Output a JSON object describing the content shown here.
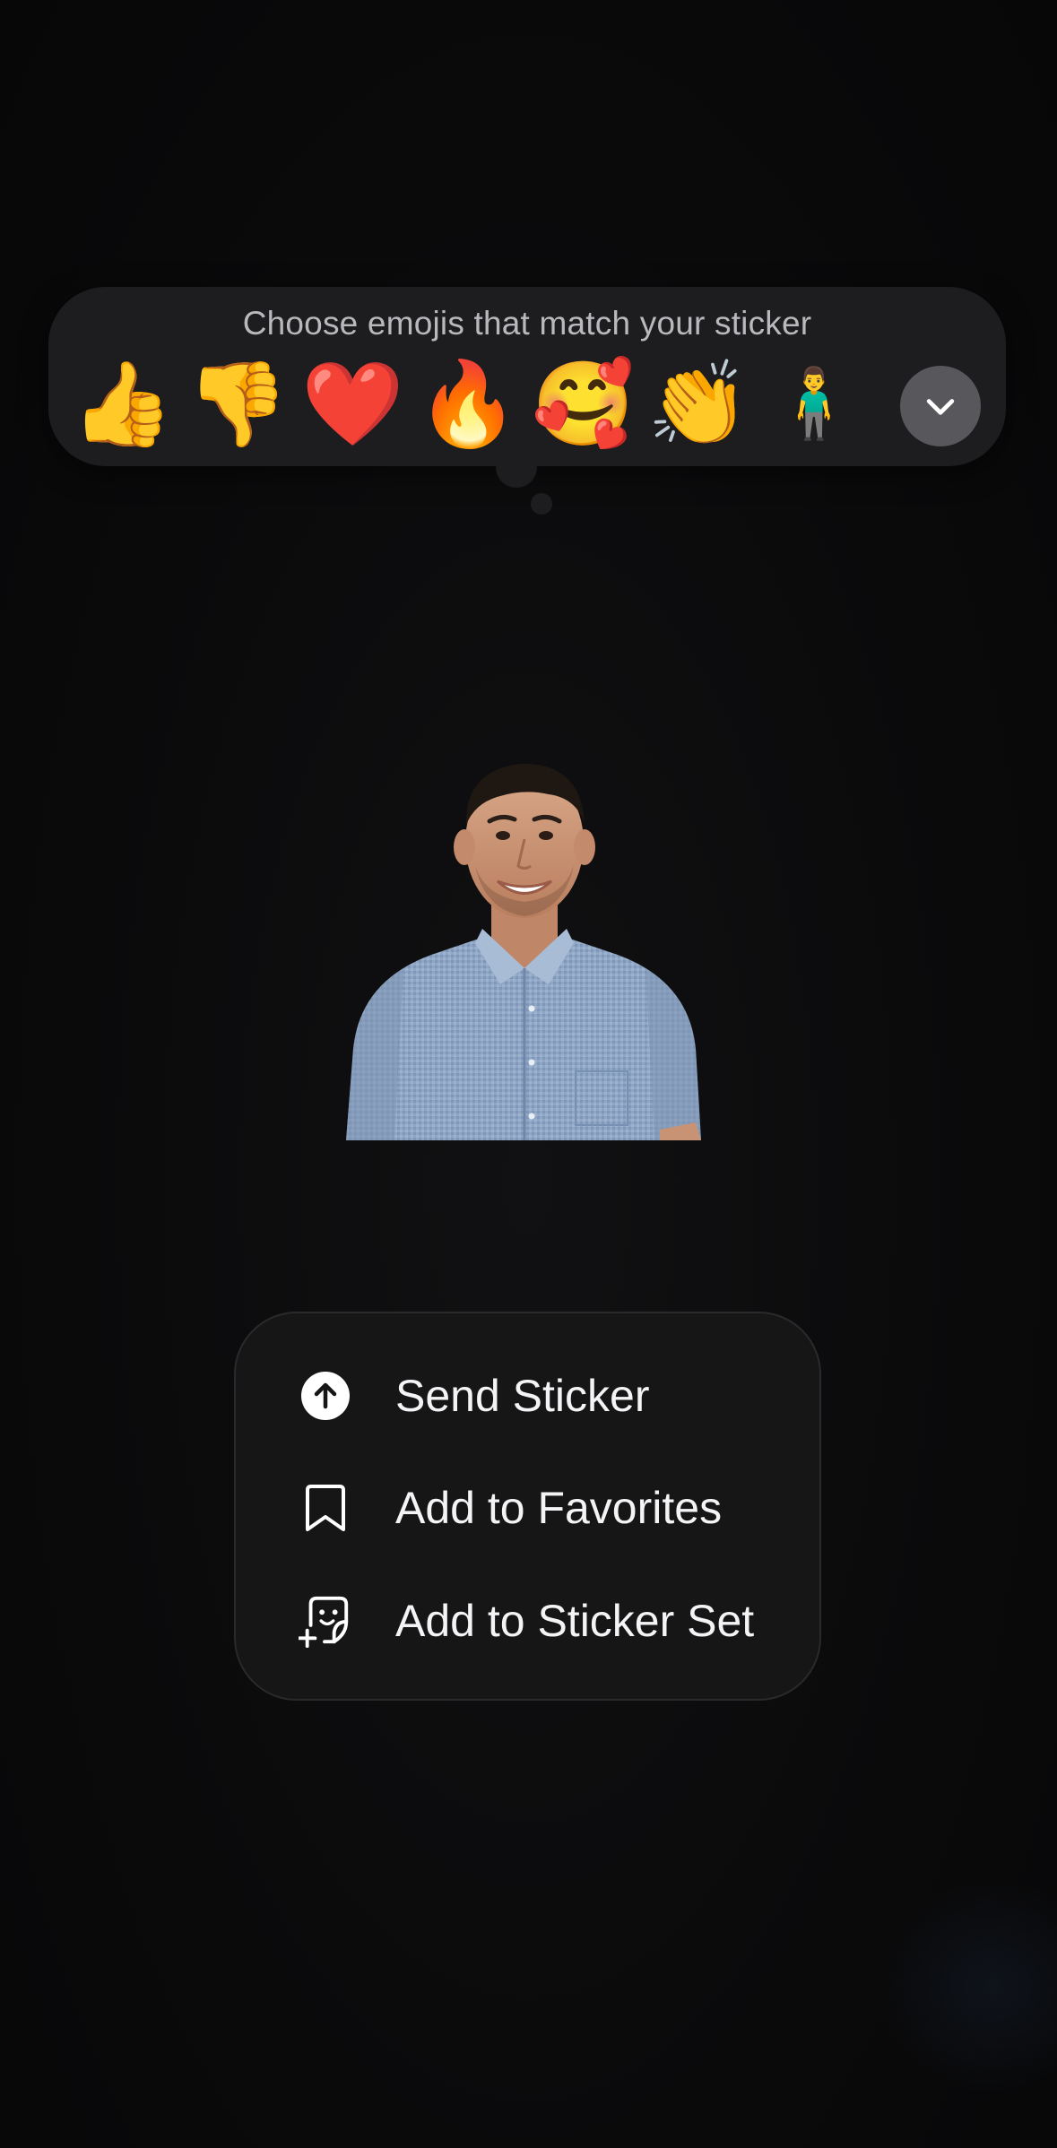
{
  "emoji_panel": {
    "title": "Choose emojis that match your sticker",
    "emojis": [
      {
        "char": "👍",
        "name": "thumbs-up"
      },
      {
        "char": "👎",
        "name": "thumbs-down"
      },
      {
        "char": "❤️",
        "name": "red-heart"
      },
      {
        "char": "🔥",
        "name": "fire"
      },
      {
        "char": "🥰",
        "name": "smiling-face-with-hearts"
      },
      {
        "char": "👏",
        "name": "clapping-hands"
      },
      {
        "char": "🧍‍♂️",
        "name": "man-standing"
      }
    ],
    "expand_icon": "chevron-down-icon"
  },
  "sticker": {
    "subject": "smiling man in blue button-up shirt"
  },
  "menu": {
    "items": [
      {
        "label": "Send Sticker",
        "icon": "arrow-up-circle-icon"
      },
      {
        "label": "Add to Favorites",
        "icon": "bookmark-icon"
      },
      {
        "label": "Add to Sticker Set",
        "icon": "sticker-add-icon"
      }
    ]
  },
  "colors": {
    "background": "#0b0b0c",
    "panel": "#1d1d1f",
    "menu": "#161617",
    "text_primary": "#f4f4f6",
    "text_secondary": "#b9b9bd",
    "expand_button": "#58585c"
  }
}
